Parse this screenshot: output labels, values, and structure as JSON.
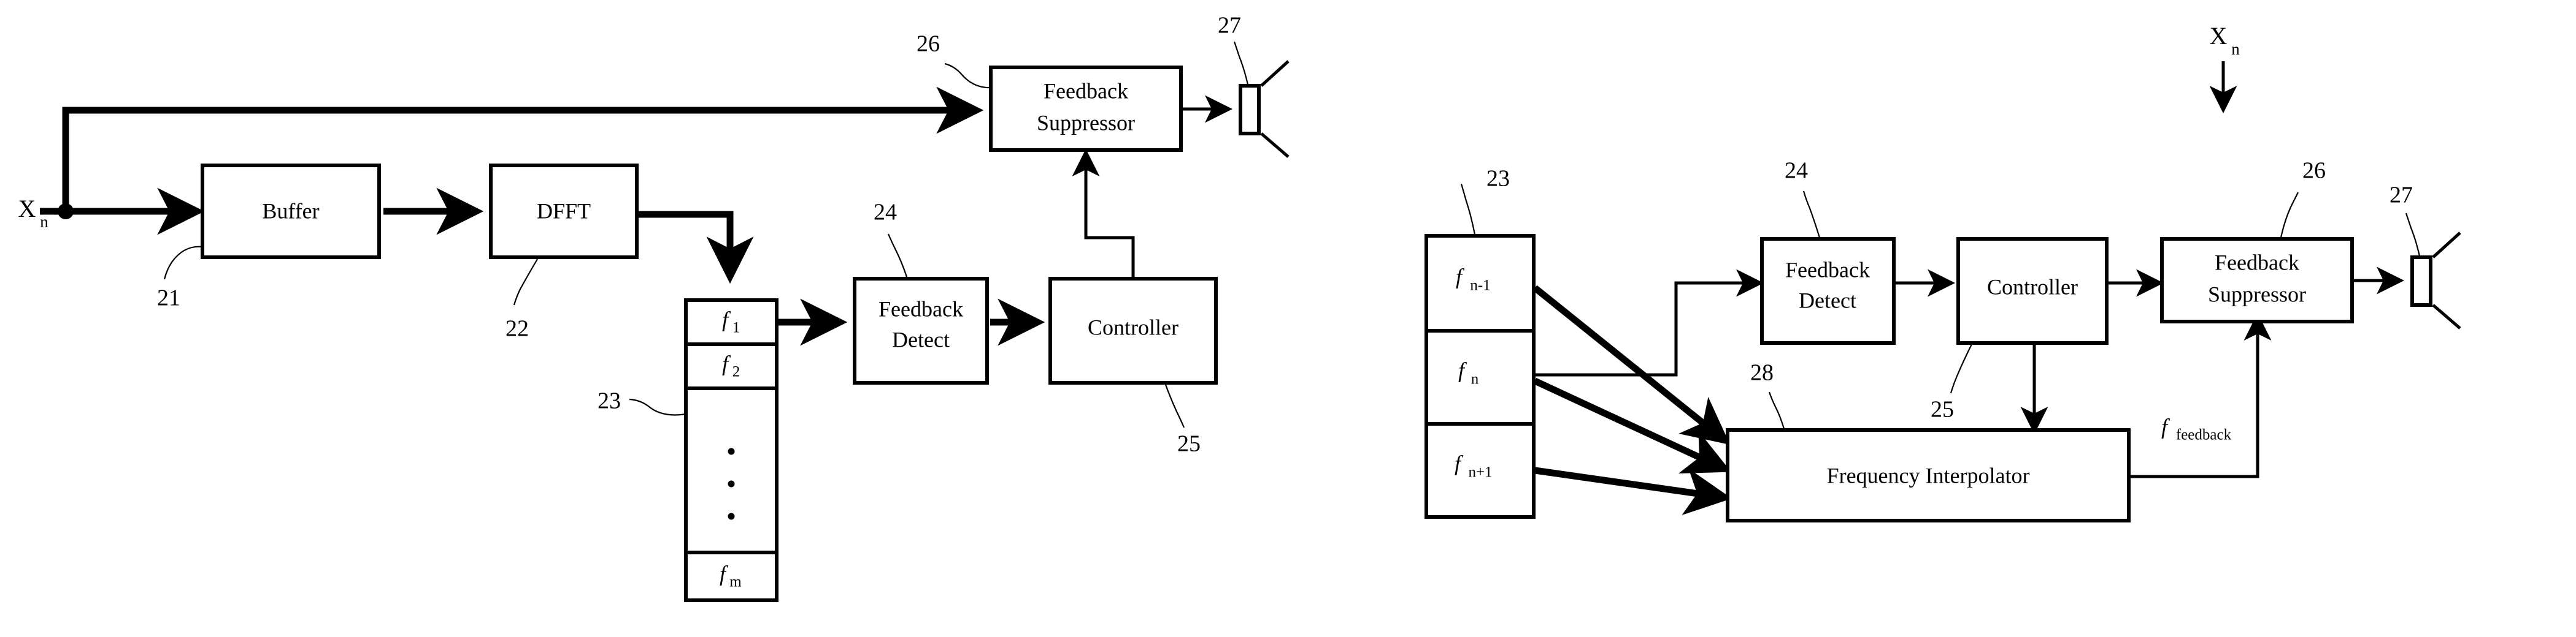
{
  "figure": {
    "type": "block-diagram",
    "description": "Two audio feedback suppression block diagrams",
    "line_color": "#000000",
    "background_color": "#ffffff"
  },
  "left_diagram": {
    "input_label": {
      "base": "X",
      "subscript": "n"
    },
    "blocks": [
      {
        "id": "buffer",
        "label": "Buffer",
        "ref": "21"
      },
      {
        "id": "dfft",
        "label": "DFFT",
        "ref": "22"
      },
      {
        "id": "feedback_detect",
        "label_line1": "Feedback",
        "label_line2": "Detect",
        "ref": "24"
      },
      {
        "id": "controller",
        "label": "Controller",
        "ref": "25"
      },
      {
        "id": "feedback_suppressor",
        "label_line1": "Feedback",
        "label_line2": "Suppressor",
        "ref": "26"
      },
      {
        "id": "speaker",
        "label": "",
        "ref": "27"
      }
    ],
    "frequency_stack": {
      "ref": "23",
      "bins": [
        {
          "base": "f",
          "subscript": "1"
        },
        {
          "base": "f",
          "subscript": "2"
        },
        {
          "base": "",
          "subscript": "",
          "dots": true
        },
        {
          "base": "f",
          "subscript": "m"
        }
      ]
    },
    "reference_numerals": [
      "21",
      "22",
      "23",
      "24",
      "25",
      "26",
      "27"
    ]
  },
  "right_diagram": {
    "input_label": {
      "base": "X",
      "subscript": "n"
    },
    "blocks": [
      {
        "id": "feedback_detect",
        "label_line1": "Feedback",
        "label_line2": "Detect",
        "ref": "24"
      },
      {
        "id": "controller",
        "label": "Controller",
        "ref": "25"
      },
      {
        "id": "feedback_suppressor",
        "label_line1": "Feedback",
        "label_line2": "Suppressor",
        "ref": "26"
      },
      {
        "id": "frequency_interpolator",
        "label": "Frequency Interpolator",
        "ref": "28"
      },
      {
        "id": "speaker",
        "label": "",
        "ref": "27"
      }
    ],
    "frequency_stack": {
      "ref": "23",
      "bins": [
        {
          "base": "f",
          "subscript": "n-1"
        },
        {
          "base": "f",
          "subscript": "n"
        },
        {
          "base": "f",
          "subscript": "n+1"
        }
      ]
    },
    "signal_label": {
      "base": "f",
      "subscript": "feedback"
    },
    "reference_numerals": [
      "23",
      "24",
      "25",
      "26",
      "27",
      "28"
    ]
  }
}
